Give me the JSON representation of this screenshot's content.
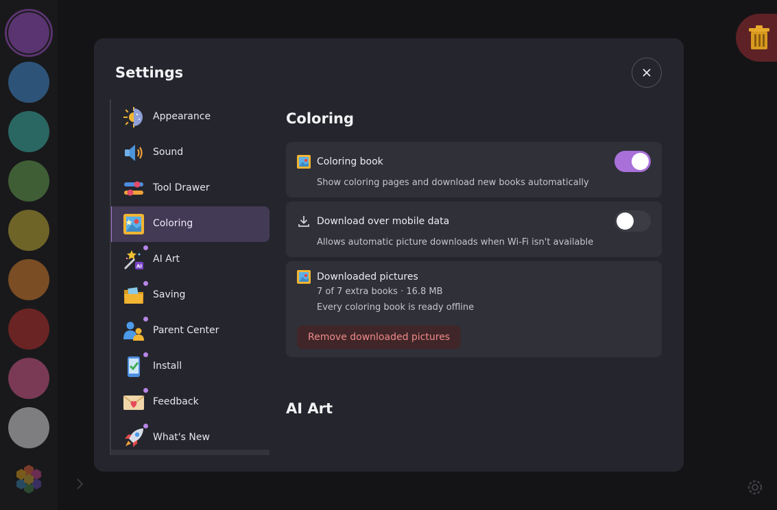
{
  "colors": {
    "swatches": [
      "#5a3470",
      "#2e5378",
      "#2a6763",
      "#3f5e35",
      "#6e6428",
      "#7a4d24",
      "#6a2424",
      "#7a3a55",
      "#7e7e80"
    ],
    "accent": "#a870d8",
    "danger": "#f08a8a"
  },
  "modal": {
    "title": "Settings",
    "close_icon": "close-icon"
  },
  "nav": {
    "items": [
      {
        "label": "Appearance",
        "icon": "sun-moon-icon"
      },
      {
        "label": "Sound",
        "icon": "speaker-icon"
      },
      {
        "label": "Tool Drawer",
        "icon": "sliders-icon"
      },
      {
        "label": "Coloring",
        "icon": "picture-frame-icon"
      },
      {
        "label": "AI Art",
        "icon": "magic-wand-icon"
      },
      {
        "label": "Saving",
        "icon": "folder-icon"
      },
      {
        "label": "Parent Center",
        "icon": "parent-child-icon"
      },
      {
        "label": "Install",
        "icon": "phone-check-icon"
      },
      {
        "label": "Feedback",
        "icon": "heart-envelope-icon"
      },
      {
        "label": "What's New",
        "icon": "rocket-icon"
      }
    ],
    "active": "Coloring"
  },
  "coloring": {
    "title": "Coloring",
    "coloring_book": {
      "title": "Coloring book",
      "description": "Show coloring pages and download new books automatically",
      "enabled": true
    },
    "mobile_data": {
      "title": "Download over mobile data",
      "description": "Allows automatic picture downloads when Wi-Fi isn't available",
      "enabled": false
    },
    "downloaded": {
      "title": "Downloaded pictures",
      "summary": "7 of 7 extra books · 16.8 MB",
      "status": "Every coloring book is ready offline",
      "remove_label": "Remove downloaded pictures"
    }
  },
  "ai_art": {
    "title": "AI Art"
  },
  "icons": {
    "trash": "trash-icon",
    "settings": "gear-icon",
    "palette": "hexagon-palette-icon",
    "expand": "chevron-right-icon"
  }
}
